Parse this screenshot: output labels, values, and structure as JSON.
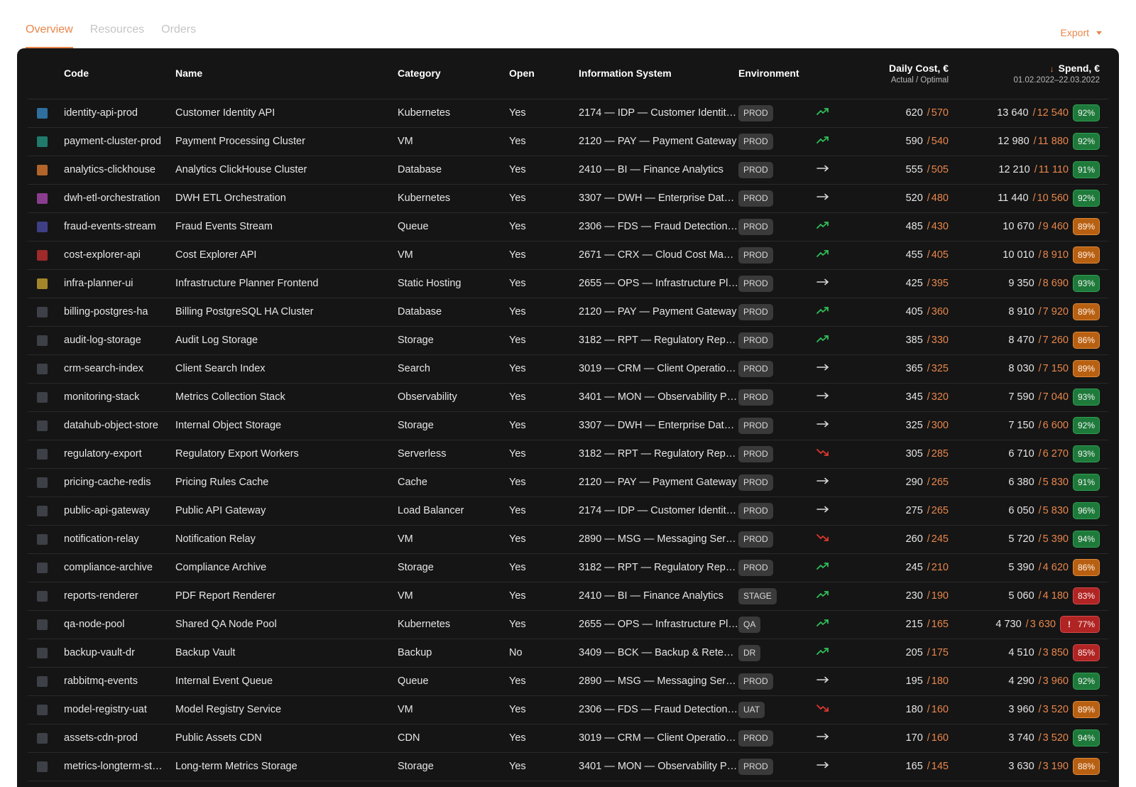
{
  "tabs": [
    {
      "label": "Overview",
      "active": true
    },
    {
      "label": "Resources",
      "active": false
    },
    {
      "label": "Orders",
      "active": false
    }
  ],
  "export_label": "Export",
  "columns": {
    "code": "Code",
    "name": "Name",
    "category": "Category",
    "open": "Open",
    "info_system": "Information System",
    "environment": "Environment",
    "daily_cost": "Daily Cost, €",
    "daily_cost_sub": "Actual / Optimal",
    "spend": "Spend, €",
    "spend_sub": "01.02.2022–22.03.2022"
  },
  "colors": {
    "accent": "#e8864b",
    "good": "#1e7a3a",
    "mid": "#b86012",
    "bad": "#b02424",
    "trend_up": "#2fbf58",
    "trend_down": "#e0362f"
  },
  "rows": [
    {
      "color": "#2e6f9e",
      "code": "identity-api-prod",
      "name": "Customer Identity API",
      "category": "Kubernetes",
      "open": "Yes",
      "system": "2174 — IDP — Customer Identit…",
      "env": "PROD",
      "trend": "up",
      "daily_actual": "620",
      "daily_optimal": "570",
      "spend_actual": "13 640",
      "spend_optimal": "12 540",
      "pct": "92%",
      "level": "good"
    },
    {
      "color": "#1f7a6c",
      "code": "payment-cluster-prod",
      "name": "Payment Processing Cluster",
      "category": "VM",
      "open": "Yes",
      "system": "2120 — PAY — Payment Gateway",
      "env": "PROD",
      "trend": "up",
      "daily_actual": "590",
      "daily_optimal": "540",
      "spend_actual": "12 980",
      "spend_optimal": "11 880",
      "pct": "92%",
      "level": "good"
    },
    {
      "color": "#b2652a",
      "code": "analytics-clickhouse",
      "name": "Analytics ClickHouse Cluster",
      "category": "Database",
      "open": "Yes",
      "system": "2410 — BI — Finance Analytics",
      "env": "PROD",
      "trend": "flat",
      "daily_actual": "555",
      "daily_optimal": "505",
      "spend_actual": "12 210",
      "spend_optimal": "11 110",
      "pct": "91%",
      "level": "good"
    },
    {
      "color": "#8a3d8f",
      "code": "dwh-etl-orchestration",
      "name": "DWH ETL Orchestration",
      "category": "Kubernetes",
      "open": "Yes",
      "system": "3307 — DWH — Enterprise Data…",
      "env": "PROD",
      "trend": "flat",
      "daily_actual": "520",
      "daily_optimal": "480",
      "spend_actual": "11 440",
      "spend_optimal": "10 560",
      "pct": "92%",
      "level": "good"
    },
    {
      "color": "#3f3f86",
      "code": "fraud-events-stream",
      "name": "Fraud Events Stream",
      "category": "Queue",
      "open": "Yes",
      "system": "2306 — FDS — Fraud Detection…",
      "env": "PROD",
      "trend": "up",
      "daily_actual": "485",
      "daily_optimal": "430",
      "spend_actual": "10 670",
      "spend_optimal": "9 460",
      "pct": "89%",
      "level": "mid"
    },
    {
      "color": "#9e2a2a",
      "code": "cost-explorer-api",
      "name": "Cost Explorer API",
      "category": "VM",
      "open": "Yes",
      "system": "2671 — CRX — Cloud Cost Man…",
      "env": "PROD",
      "trend": "up",
      "daily_actual": "455",
      "daily_optimal": "405",
      "spend_actual": "10 010",
      "spend_optimal": "8 910",
      "pct": "89%",
      "level": "mid"
    },
    {
      "color": "#a3862a",
      "code": "infra-planner-ui",
      "name": "Infrastructure Planner Frontend",
      "category": "Static Hosting",
      "open": "Yes",
      "system": "2655 — OPS — Infrastructure Pl…",
      "env": "PROD",
      "trend": "flat",
      "daily_actual": "425",
      "daily_optimal": "395",
      "spend_actual": "9 350",
      "spend_optimal": "8 690",
      "pct": "93%",
      "level": "good"
    },
    {
      "color": "#3e4047",
      "code": "billing-postgres-ha",
      "name": "Billing PostgreSQL HA Cluster",
      "category": "Database",
      "open": "Yes",
      "system": "2120 — PAY — Payment Gateway",
      "env": "PROD",
      "trend": "up",
      "daily_actual": "405",
      "daily_optimal": "360",
      "spend_actual": "8 910",
      "spend_optimal": "7 920",
      "pct": "89%",
      "level": "mid"
    },
    {
      "color": "#3e4047",
      "code": "audit-log-storage",
      "name": "Audit Log Storage",
      "category": "Storage",
      "open": "Yes",
      "system": "3182 — RPT — Regulatory Repo…",
      "env": "PROD",
      "trend": "up",
      "daily_actual": "385",
      "daily_optimal": "330",
      "spend_actual": "8 470",
      "spend_optimal": "7 260",
      "pct": "86%",
      "level": "mid"
    },
    {
      "color": "#3e4047",
      "code": "crm-search-index",
      "name": "Client Search Index",
      "category": "Search",
      "open": "Yes",
      "system": "3019 — CRM — Client Operation…",
      "env": "PROD",
      "trend": "flat",
      "daily_actual": "365",
      "daily_optimal": "325",
      "spend_actual": "8 030",
      "spend_optimal": "7 150",
      "pct": "89%",
      "level": "mid"
    },
    {
      "color": "#3e4047",
      "code": "monitoring-stack",
      "name": "Metrics Collection Stack",
      "category": "Observability",
      "open": "Yes",
      "system": "3401 — MON — Observability Pl…",
      "env": "PROD",
      "trend": "flat",
      "daily_actual": "345",
      "daily_optimal": "320",
      "spend_actual": "7 590",
      "spend_optimal": "7 040",
      "pct": "93%",
      "level": "good"
    },
    {
      "color": "#3e4047",
      "code": "datahub-object-store",
      "name": "Internal Object Storage",
      "category": "Storage",
      "open": "Yes",
      "system": "3307 — DWH — Enterprise Data…",
      "env": "PROD",
      "trend": "flat",
      "daily_actual": "325",
      "daily_optimal": "300",
      "spend_actual": "7 150",
      "spend_optimal": "6 600",
      "pct": "92%",
      "level": "good"
    },
    {
      "color": "#3e4047",
      "code": "regulatory-export",
      "name": "Regulatory Export Workers",
      "category": "Serverless",
      "open": "Yes",
      "system": "3182 — RPT — Regulatory Repo…",
      "env": "PROD",
      "trend": "down",
      "daily_actual": "305",
      "daily_optimal": "285",
      "spend_actual": "6 710",
      "spend_optimal": "6 270",
      "pct": "93%",
      "level": "good"
    },
    {
      "color": "#3e4047",
      "code": "pricing-cache-redis",
      "name": "Pricing Rules Cache",
      "category": "Cache",
      "open": "Yes",
      "system": "2120 — PAY — Payment Gateway",
      "env": "PROD",
      "trend": "flat",
      "daily_actual": "290",
      "daily_optimal": "265",
      "spend_actual": "6 380",
      "spend_optimal": "5 830",
      "pct": "91%",
      "level": "good"
    },
    {
      "color": "#3e4047",
      "code": "public-api-gateway",
      "name": "Public API Gateway",
      "category": "Load Balancer",
      "open": "Yes",
      "system": "2174 — IDP — Customer Identit…",
      "env": "PROD",
      "trend": "flat",
      "daily_actual": "275",
      "daily_optimal": "265",
      "spend_actual": "6 050",
      "spend_optimal": "5 830",
      "pct": "96%",
      "level": "good"
    },
    {
      "color": "#3e4047",
      "code": "notification-relay",
      "name": "Notification Relay",
      "category": "VM",
      "open": "Yes",
      "system": "2890 — MSG — Messaging Serv…",
      "env": "PROD",
      "trend": "down",
      "daily_actual": "260",
      "daily_optimal": "245",
      "spend_actual": "5 720",
      "spend_optimal": "5 390",
      "pct": "94%",
      "level": "good"
    },
    {
      "color": "#3e4047",
      "code": "compliance-archive",
      "name": "Compliance Archive",
      "category": "Storage",
      "open": "Yes",
      "system": "3182 — RPT — Regulatory Repo…",
      "env": "PROD",
      "trend": "up",
      "daily_actual": "245",
      "daily_optimal": "210",
      "spend_actual": "5 390",
      "spend_optimal": "4 620",
      "pct": "86%",
      "level": "mid"
    },
    {
      "color": "#3e4047",
      "code": "reports-renderer",
      "name": "PDF Report Renderer",
      "category": "VM",
      "open": "Yes",
      "system": "2410 — BI — Finance Analytics",
      "env": "STAGE",
      "trend": "up",
      "daily_actual": "230",
      "daily_optimal": "190",
      "spend_actual": "5 060",
      "spend_optimal": "4 180",
      "pct": "83%",
      "level": "bad"
    },
    {
      "color": "#3e4047",
      "code": "qa-node-pool",
      "name": "Shared QA Node Pool",
      "category": "Kubernetes",
      "open": "Yes",
      "system": "2655 — OPS — Infrastructure Pl…",
      "env": "QA",
      "trend": "up",
      "daily_actual": "215",
      "daily_optimal": "165",
      "spend_actual": "4 730",
      "spend_optimal": "3 630",
      "pct": "77%",
      "level": "alert",
      "alert_mark": "!"
    },
    {
      "color": "#3e4047",
      "code": "backup-vault-dr",
      "name": "Backup Vault",
      "category": "Backup",
      "open": "No",
      "system": "3409 — BCK — Backup & Retent…",
      "env": "DR",
      "trend": "up",
      "daily_actual": "205",
      "daily_optimal": "175",
      "spend_actual": "4 510",
      "spend_optimal": "3 850",
      "pct": "85%",
      "level": "bad"
    },
    {
      "color": "#3e4047",
      "code": "rabbitmq-events",
      "name": "Internal Event Queue",
      "category": "Queue",
      "open": "Yes",
      "system": "2890 — MSG — Messaging Serv…",
      "env": "PROD",
      "trend": "flat",
      "daily_actual": "195",
      "daily_optimal": "180",
      "spend_actual": "4 290",
      "spend_optimal": "3 960",
      "pct": "92%",
      "level": "good"
    },
    {
      "color": "#3e4047",
      "code": "model-registry-uat",
      "name": "Model Registry Service",
      "category": "VM",
      "open": "Yes",
      "system": "2306 — FDS — Fraud Detection…",
      "env": "UAT",
      "trend": "down",
      "daily_actual": "180",
      "daily_optimal": "160",
      "spend_actual": "3 960",
      "spend_optimal": "3 520",
      "pct": "89%",
      "level": "mid"
    },
    {
      "color": "#3e4047",
      "code": "assets-cdn-prod",
      "name": "Public Assets CDN",
      "category": "CDN",
      "open": "Yes",
      "system": "3019 — CRM — Client Operation…",
      "env": "PROD",
      "trend": "flat",
      "daily_actual": "170",
      "daily_optimal": "160",
      "spend_actual": "3 740",
      "spend_optimal": "3 520",
      "pct": "94%",
      "level": "good"
    },
    {
      "color": "#3e4047",
      "code": "metrics-longterm-st…",
      "name": "Long-term Metrics Storage",
      "category": "Storage",
      "open": "Yes",
      "system": "3401 — MON — Observability Pl…",
      "env": "PROD",
      "trend": "flat",
      "daily_actual": "165",
      "daily_optimal": "145",
      "spend_actual": "3 630",
      "spend_optimal": "3 190",
      "pct": "88%",
      "level": "mid"
    }
  ]
}
